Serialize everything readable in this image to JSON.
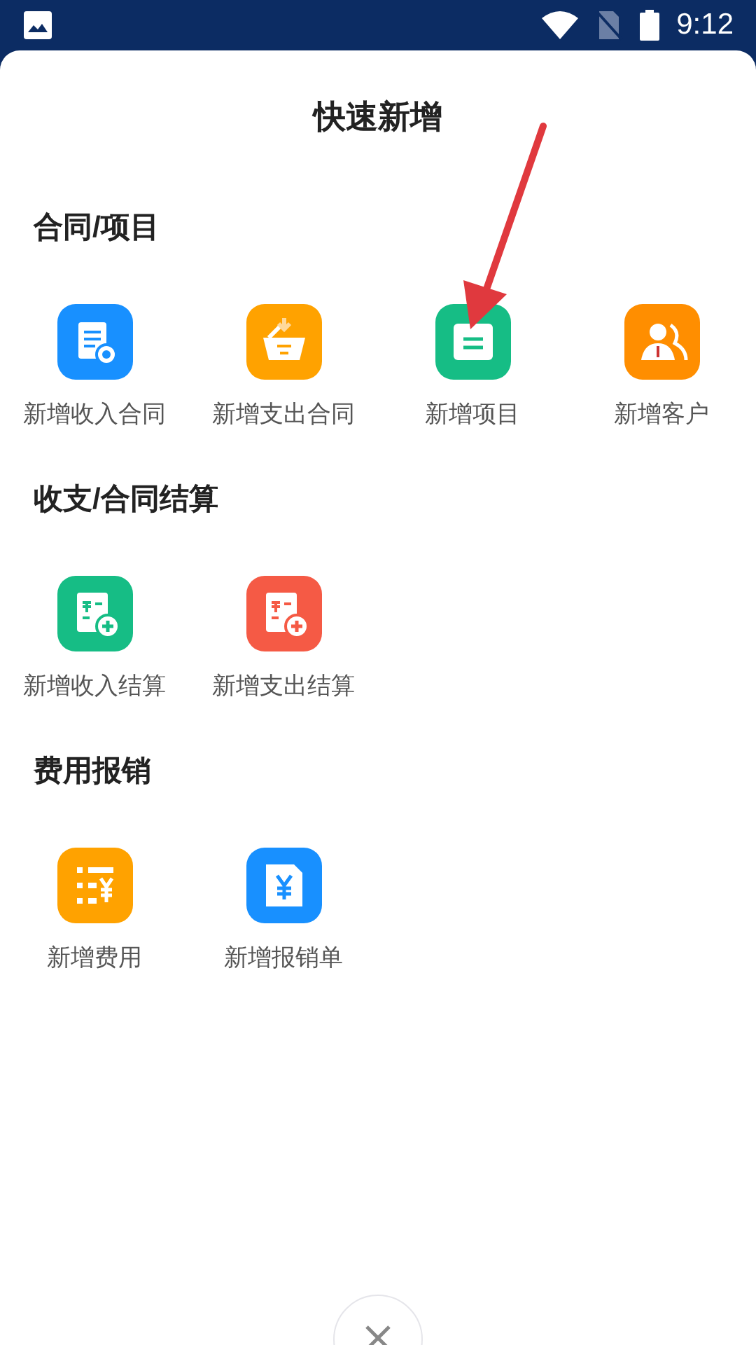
{
  "status_bar": {
    "time": "9:12"
  },
  "sheet": {
    "title": "快速新增"
  },
  "sections": [
    {
      "title": "合同/项目",
      "items": [
        {
          "label": "新增收入合同",
          "kind": "contract",
          "color": "#1890ff"
        },
        {
          "label": "新增支出合同",
          "kind": "basket",
          "color": "#ffa200"
        },
        {
          "label": "新增项目",
          "kind": "folder",
          "color": "#16bd85"
        },
        {
          "label": "新增客户",
          "kind": "people",
          "color": "#ff8e00"
        }
      ]
    },
    {
      "title": "收支/合同结算",
      "items": [
        {
          "label": "新增收入结算",
          "kind": "settle",
          "color": "#16bd85"
        },
        {
          "label": "新增支出结算",
          "kind": "settle",
          "color": "#f55a45"
        }
      ]
    },
    {
      "title": "费用报销",
      "items": [
        {
          "label": "新增费用",
          "kind": "list",
          "color": "#ffa200"
        },
        {
          "label": "新增报销单",
          "kind": "doc",
          "color": "#1890ff"
        }
      ]
    }
  ]
}
